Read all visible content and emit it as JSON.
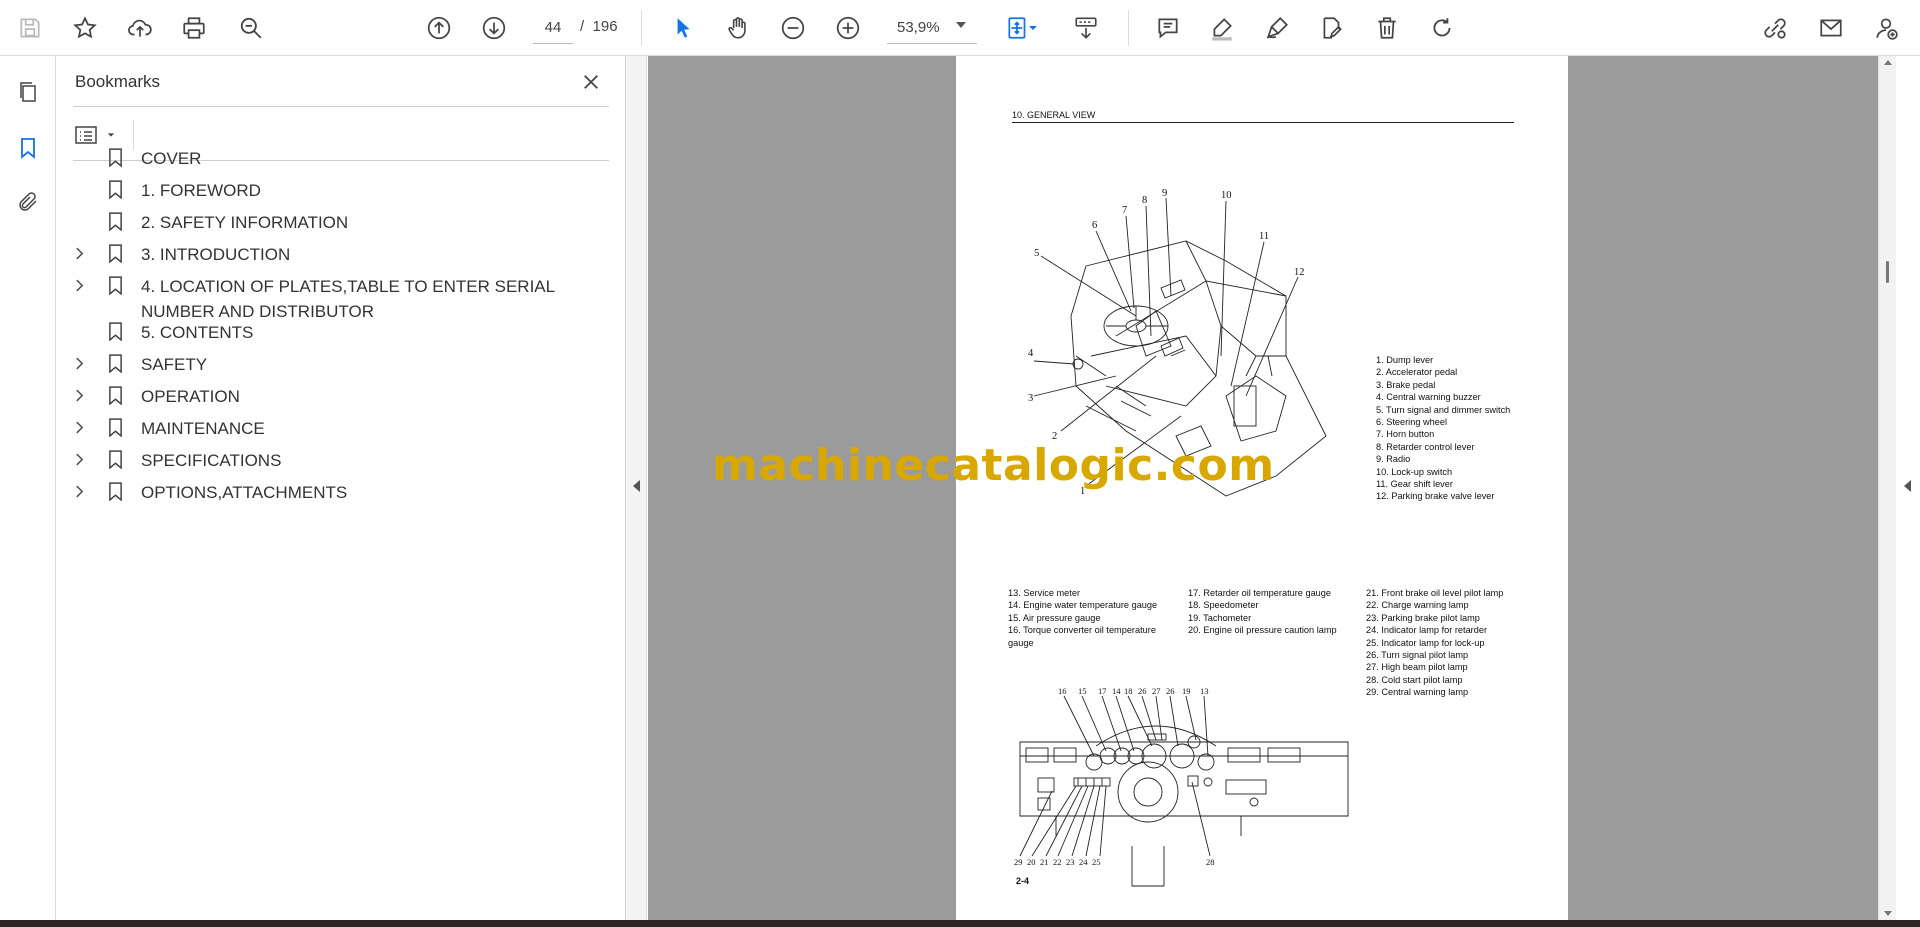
{
  "toolbar": {
    "page_current": "44",
    "page_separator": "/",
    "page_total": "196",
    "zoom": "53,9%"
  },
  "bookmarks": {
    "title": "Bookmarks",
    "items": [
      {
        "label": "COVER",
        "expandable": false
      },
      {
        "label": "1. FOREWORD",
        "expandable": false
      },
      {
        "label": "2. SAFETY INFORMATION",
        "expandable": false
      },
      {
        "label": "3. INTRODUCTION",
        "expandable": true
      },
      {
        "label": "4. LOCATION OF PLATES,TABLE TO ENTER SERIAL NUMBER AND DISTRIBUTOR",
        "expandable": true
      },
      {
        "label": "5. CONTENTS",
        "expandable": false
      },
      {
        "label": "SAFETY",
        "expandable": true
      },
      {
        "label": "OPERATION",
        "expandable": true
      },
      {
        "label": "MAINTENANCE",
        "expandable": true
      },
      {
        "label": "SPECIFICATIONS",
        "expandable": true
      },
      {
        "label": "OPTIONS,ATTACHMENTS",
        "expandable": true
      }
    ]
  },
  "document": {
    "section_header": "10.  GENERAL VIEW",
    "page_number": "2-4",
    "legend_top": [
      "1. Dump lever",
      "2. Accelerator pedal",
      "3. Brake pedal",
      "4. Central warning buzzer",
      "5. Turn signal and dimmer switch",
      "6. Steering wheel",
      "7. Horn button",
      "8. Retarder control lever",
      "9. Radio",
      "10. Lock-up switch",
      "11. Gear shift lever",
      "12. Parking brake valve lever"
    ],
    "legend_col1": [
      "13.  Service meter",
      "14.  Engine water temperature gauge",
      "15.  Air pressure gauge",
      "16.  Torque converter oil temperature",
      "       gauge"
    ],
    "legend_col2": [
      "17.  Retarder oil temperature gauge",
      "18.  Speedometer",
      "19.  Tachometer",
      "20.  Engine oil pressure caution lamp"
    ],
    "legend_col3": [
      "21.  Front brake oil level pilot lamp",
      "22.  Charge warning lamp",
      "23.  Parking brake pilot lamp",
      "24.  Indicator lamp for retarder",
      "25.  Indicator lamp for lock-up",
      "26.  Turn signal pilot lamp",
      "27.  High beam pilot lamp",
      "28.  Cold start pilot lamp",
      "29.  Central warning lamp"
    ],
    "cab_callouts": [
      "1",
      "2",
      "3",
      "4",
      "5",
      "6",
      "7",
      "8",
      "9",
      "10",
      "11",
      "12"
    ],
    "panel_callouts_top": [
      "16",
      "15",
      "17",
      "14",
      "18",
      "26",
      "27",
      "26",
      "19",
      "13"
    ],
    "panel_callouts_bottom": [
      "29",
      "20",
      "21",
      "22",
      "23",
      "24",
      "25"
    ],
    "panel_callout_28": "28"
  },
  "watermark": "machinecatalogic.com",
  "colors": {
    "accent_blue": "#1473e6",
    "viewer_bg": "#9b9b9b",
    "watermark": "#d9a800"
  }
}
